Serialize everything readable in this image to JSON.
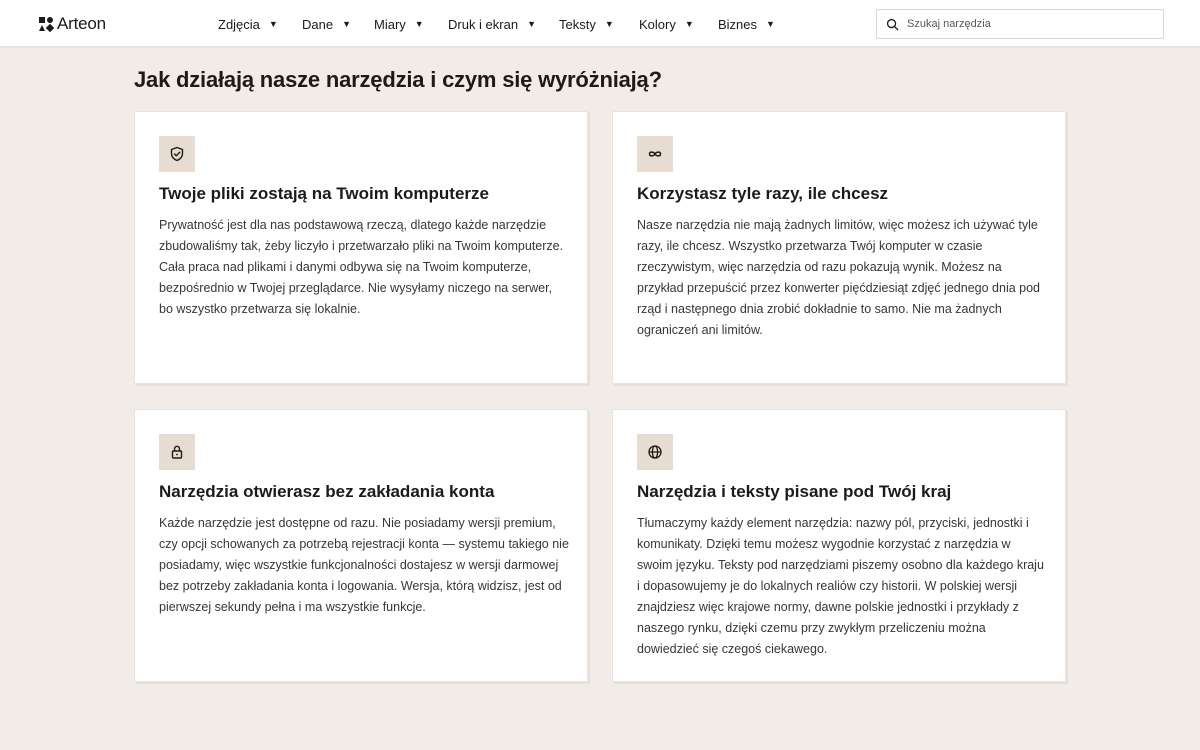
{
  "app": {
    "logo_text": "Arteon",
    "logo_icon": "arteon-logo-icon"
  },
  "nav": {
    "items": [
      {
        "label": "Zdjęcia",
        "icon": "caret-down-icon"
      },
      {
        "label": "Dane",
        "icon": "caret-down-icon"
      },
      {
        "label": "Miary",
        "icon": "caret-down-icon"
      },
      {
        "label": "Druk i ekran",
        "icon": "caret-down-icon"
      },
      {
        "label": "Teksty",
        "icon": "caret-down-icon"
      },
      {
        "label": "Kolory",
        "icon": "caret-down-icon"
      },
      {
        "label": "Biznes",
        "icon": "caret-down-icon"
      }
    ],
    "caret": "▼"
  },
  "search": {
    "placeholder": "Szukaj narzędzia",
    "value": "",
    "icon": "search-icon"
  },
  "section": {
    "title": "Jak działają nasze narzędzia i czym się wyróżniają?"
  },
  "cards": [
    {
      "icon": "shield-check-icon",
      "title": "Twoje pliki zostają na Twoim komputerze",
      "text": "Prywatność jest dla nas podstawową rzeczą, dlatego każde narzędzie zbudowaliśmy tak, żeby liczyło i przetwarzało pliki na Twoim komputerze. Cała praca nad plikami i danymi odbywa się na Twoim komputerze, bezpośrednio w Twojej przeglądarce. Nie wysyłamy niczego na serwer, bo wszystko przetwarza się lokalnie."
    },
    {
      "icon": "infinity-icon",
      "title": "Korzystasz tyle razy, ile chcesz",
      "text": "Nasze narzędzia nie mają żadnych limitów, więc możesz ich używać tyle razy, ile chcesz. Wszystko przetwarza Twój komputer w czasie rzeczywistym, więc narzędzia od razu pokazują wynik. Możesz na przykład przepuścić przez konwerter pięćdziesiąt zdjęć jednego dnia pod rząd i następnego dnia zrobić dokładnie to samo. Nie ma żadnych ograniczeń ani limitów."
    },
    {
      "icon": "lock-icon",
      "title": "Narzędzia otwierasz bez zakładania konta",
      "text": "Każde narzędzie jest dostępne od razu. Nie posiadamy wersji premium, czy opcji schowanych za potrzebą rejestracji konta — systemu takiego nie posiadamy, więc wszystkie funkcjonalności dostajesz w wersji darmowej bez potrzeby zakładania konta i logowania. Wersja, którą widzisz, jest od pierwszej sekundy pełna i ma wszystkie funkcje."
    },
    {
      "icon": "globe-icon",
      "title": "Narzędzia i teksty pisane pod Twój kraj",
      "text": "Tłumaczymy każdy element narzędzia: nazwy pól, przyciski, jednostki i komunikaty. Dzięki temu możesz wygodnie korzystać z narzędzia w swoim języku. Teksty pod narzędziami piszemy osobno dla każdego kraju i dopasowujemy je do lokalnych realiów czy historii. W polskiej wersji znajdziesz więc krajowe normy, dawne polskie jednostki i przykłady z naszego rynku, dzięki czemu przy zwykłym przeliczeniu można dowiedzieć się czegoś ciekawego."
    }
  ],
  "colors": {
    "page_background": "#f1ece7",
    "card_background": "#ffffff",
    "icon_box": "#e6dcd2",
    "text_primary": "#1e1a17",
    "text_body": "#3a3632"
  }
}
